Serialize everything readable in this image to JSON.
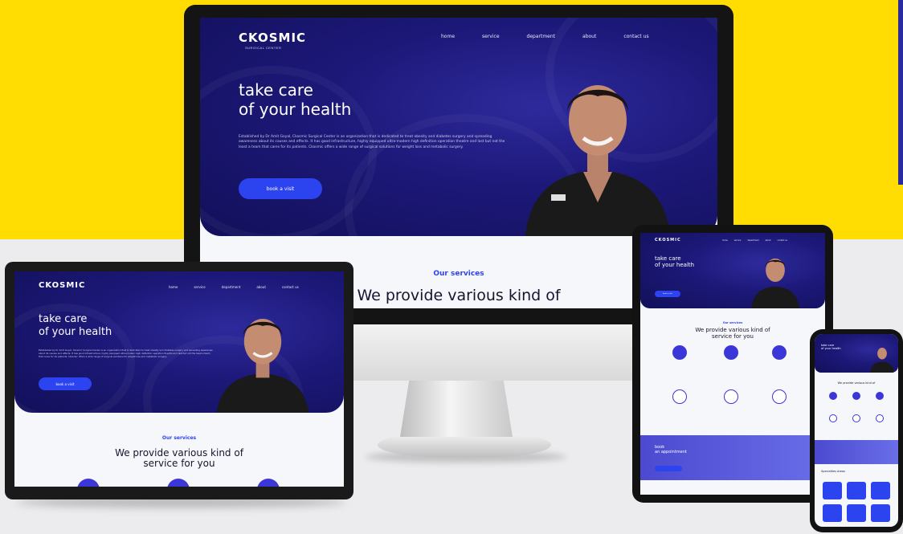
{
  "site": {
    "logo": "CKOSMIC",
    "logo_tagline": "SURGICAL CENTER",
    "nav": [
      "home",
      "service",
      "department",
      "about",
      "contact us"
    ],
    "headline_line1": "take care",
    "headline_line2": "of your health",
    "description": "Established by Dr Amit Goyal, Ckosmic Surgical Center is an organization that is dedicated to treat obesity and diabetes surgery and spreading awareness about its causes and effects. It has good infrastructure, highly equipped ultra-modern high definition operation theatre and last but not the least a team that cares for its patients. Ckosmic offers a wide range of surgical solutions for weight loss and metabolic surgery.",
    "cta": "book a visit",
    "services_label": "Our services",
    "services_title_line1": "We provide various kind of",
    "services_title_line2": "service for you",
    "appointment_line1": "book",
    "appointment_line2": "an appointment",
    "specialties_title": "Specialties Areas"
  },
  "colors": {
    "yellow": "#ffdc02",
    "navy": "#1c1878",
    "accent_blue": "#2c43f0",
    "service_purple": "#3a36d8",
    "light_bg": "#f6f7fb"
  },
  "icons": {
    "doctor": "person-silhouette",
    "service": "medical-circle-icon"
  }
}
